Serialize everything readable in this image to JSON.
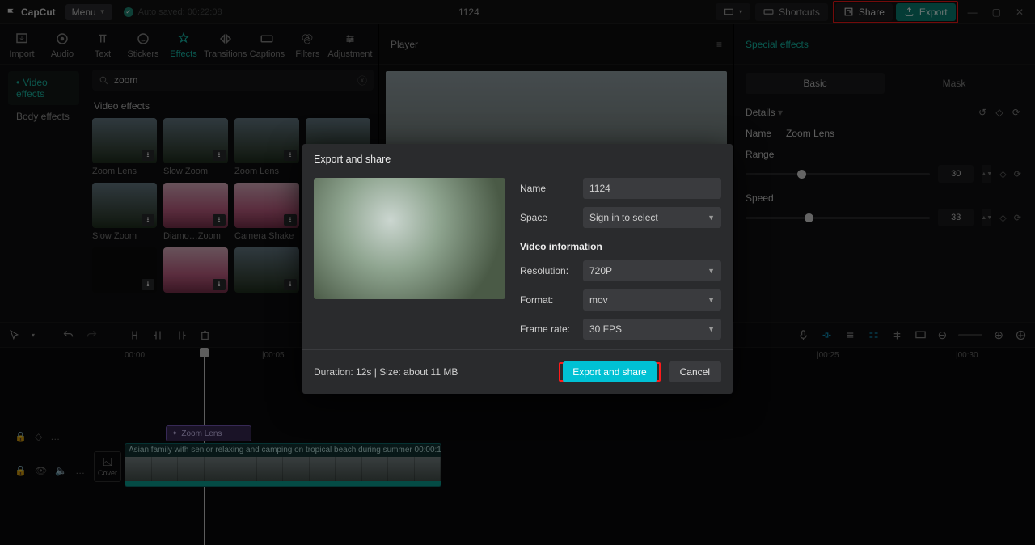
{
  "app": {
    "name": "CapCut"
  },
  "topbar": {
    "menu": "Menu",
    "autosave": "Auto saved: 00:22:08",
    "title": "1124",
    "shortcuts": "Shortcuts",
    "share": "Share",
    "export": "Export"
  },
  "categories": {
    "import": "Import",
    "audio": "Audio",
    "text": "Text",
    "stickers": "Stickers",
    "effects": "Effects",
    "transitions": "Transitions",
    "captions": "Captions",
    "filters": "Filters",
    "adjustment": "Adjustment"
  },
  "side": {
    "video_effects": "Video effects",
    "body_effects": "Body effects"
  },
  "browse": {
    "search_value": "zoom",
    "section": "Video effects",
    "items": [
      {
        "label": "Zoom Lens",
        "variant": "mtn"
      },
      {
        "label": "Slow Zoom",
        "variant": "mtn"
      },
      {
        "label": "Zoom Lens",
        "variant": "mtn"
      },
      {
        "label": "",
        "variant": "mtn"
      },
      {
        "label": "Slow Zoom",
        "variant": "mtn"
      },
      {
        "label": "Diamo…Zoom",
        "variant": "pink"
      },
      {
        "label": "Camera Shake",
        "variant": "pink"
      },
      {
        "label": "",
        "variant": "none"
      },
      {
        "label": "",
        "variant": "dark"
      },
      {
        "label": "",
        "variant": "pink"
      },
      {
        "label": "",
        "variant": "mtn"
      },
      {
        "label": "",
        "variant": "none"
      }
    ]
  },
  "player": {
    "label": "Player"
  },
  "panel": {
    "title": "Special effects",
    "tabs": {
      "basic": "Basic",
      "mask": "Mask"
    },
    "details": "Details",
    "name_label": "Name",
    "name_value": "Zoom Lens",
    "range_label": "Range",
    "range_value": "30",
    "speed_label": "Speed",
    "speed_value": "33"
  },
  "ruler": {
    "t0": "00:00",
    "t1": "|00:05",
    "t2": "|00:25",
    "t3": "|00:30"
  },
  "tracks": {
    "cover": "Cover",
    "fx": "Zoom Lens",
    "clip": "Asian family with senior relaxing and camping on tropical beach during summer   00:00:1"
  },
  "modal": {
    "title": "Export and share",
    "name_label": "Name",
    "name_value": "1124",
    "space_label": "Space",
    "space_value": "Sign in to select",
    "info_header": "Video information",
    "res_label": "Resolution:",
    "res_value": "720P",
    "fmt_label": "Format:",
    "fmt_value": "mov",
    "fps_label": "Frame rate:",
    "fps_value": "30 FPS",
    "duration": "Duration: 12s | Size: about 11 MB",
    "export_btn": "Export and share",
    "cancel_btn": "Cancel"
  }
}
